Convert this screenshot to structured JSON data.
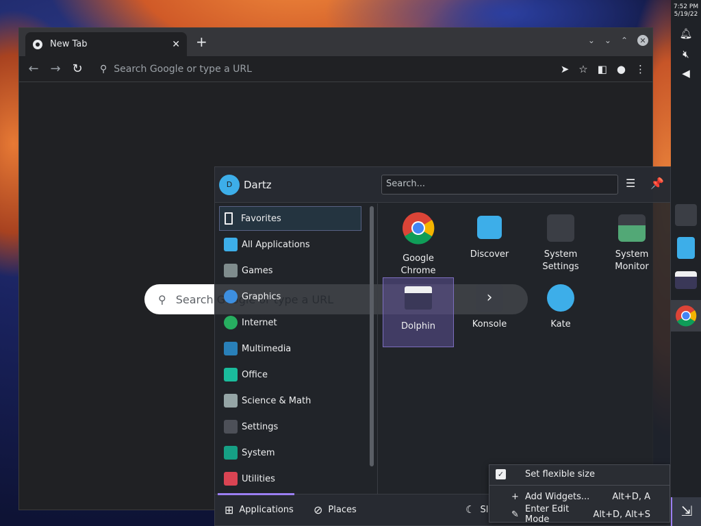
{
  "browser": {
    "tab_title": "New Tab",
    "omnibox_placeholder": "Search Google or type a URL",
    "ntp_search_placeholder": "Search Google or type a URL"
  },
  "kickoff": {
    "username": "Dartz",
    "avatar_initial": "D",
    "search_placeholder": "Search...",
    "categories": [
      {
        "label": "Favorites",
        "icon": "bookmark-icon"
      },
      {
        "label": "All Applications",
        "icon": "grid-icon"
      },
      {
        "label": "Games",
        "icon": "gamepad-icon"
      },
      {
        "label": "Graphics",
        "icon": "graphics-icon"
      },
      {
        "label": "Internet",
        "icon": "globe-icon"
      },
      {
        "label": "Multimedia",
        "icon": "multimedia-icon"
      },
      {
        "label": "Office",
        "icon": "office-icon"
      },
      {
        "label": "Science & Math",
        "icon": "flask-icon"
      },
      {
        "label": "Settings",
        "icon": "settings-icon"
      },
      {
        "label": "System",
        "icon": "system-icon"
      },
      {
        "label": "Utilities",
        "icon": "toolbox-icon"
      }
    ],
    "apps": [
      {
        "label": "Google Chrome",
        "line1": "Google",
        "line2": "Chrome"
      },
      {
        "label": "Discover",
        "line1": "Discover",
        "line2": ""
      },
      {
        "label": "System Settings",
        "line1": "System",
        "line2": "Settings"
      },
      {
        "label": "System Monitor",
        "line1": "System",
        "line2": "Monitor"
      },
      {
        "label": "Dolphin",
        "line1": "Dolphin",
        "line2": ""
      },
      {
        "label": "Konsole",
        "line1": "Konsole",
        "line2": ""
      },
      {
        "label": "Kate",
        "line1": "Kate",
        "line2": ""
      }
    ],
    "footer": {
      "applications_label": "Applications",
      "places_label": "Places",
      "sleep_label": "Sl"
    }
  },
  "context_menu": {
    "items": [
      {
        "label": "Set flexible size",
        "checked": true,
        "shortcut": ""
      },
      {
        "label": "Add Widgets...",
        "shortcut": "Alt+D, A"
      },
      {
        "label": "Enter Edit Mode",
        "shortcut": "Alt+D, Alt+S"
      }
    ]
  },
  "panel": {
    "time": "7:52 PM",
    "date": "5/19/22"
  },
  "colors": {
    "accent": "#9b7ff3",
    "chrome_bg": "#202124",
    "menu_bg": "#21242a"
  }
}
